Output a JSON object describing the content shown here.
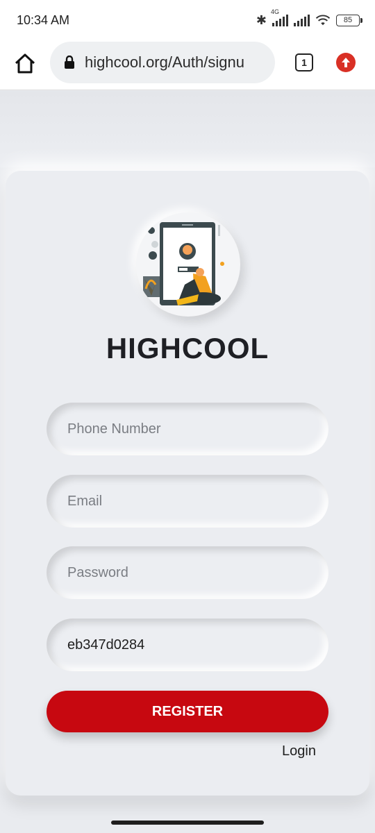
{
  "status_bar": {
    "time": "10:34 AM",
    "network_label": "4G",
    "battery": "85"
  },
  "browser": {
    "url": "highcool.org/Auth/signu",
    "tab_count": "1"
  },
  "page": {
    "brand": "HIGHCOOL",
    "fields": {
      "phone": {
        "placeholder": "Phone Number",
        "value": ""
      },
      "email": {
        "placeholder": "Email",
        "value": ""
      },
      "password": {
        "placeholder": "Password",
        "value": ""
      },
      "invite_code": {
        "placeholder": "",
        "value": "eb347d0284"
      }
    },
    "register_label": "REGISTER",
    "login_label": "Login"
  },
  "colors": {
    "accent": "#c70810",
    "background": "#e9ebef",
    "update_badge": "#d93025"
  },
  "icons": {
    "home": "home-icon",
    "lock": "lock-icon",
    "update": "arrow-up-icon",
    "bluetooth": "bluetooth-icon",
    "wifi": "wifi-icon"
  }
}
